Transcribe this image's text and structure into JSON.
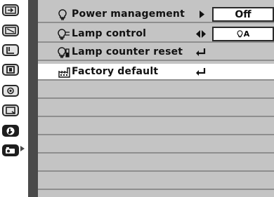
{
  "menu": {
    "items": [
      {
        "label": "Power management",
        "icon": "power-bulb-icon",
        "value": "Off",
        "action": "right-arrow-icon"
      },
      {
        "label": "Lamp control",
        "icon": "lamp-control-icon",
        "value": "A",
        "action": "left-right-arrow-icon"
      },
      {
        "label": "Lamp counter reset",
        "icon": "lamp-counter-icon",
        "action": "enter-icon"
      },
      {
        "label": "Factory default",
        "icon": "factory-default-icon",
        "action": "enter-icon"
      }
    ],
    "empty_rows": 7
  },
  "sidebar": {
    "tabs": [
      {
        "name": "input-icon"
      },
      {
        "name": "image-select-icon"
      },
      {
        "name": "image-adjust-icon"
      },
      {
        "name": "screen-icon"
      },
      {
        "name": "color-icon"
      },
      {
        "name": "setting-icon"
      },
      {
        "name": "info-icon"
      },
      {
        "name": "projector-icon"
      }
    ],
    "active_index": 7
  },
  "colors": {
    "panel": "#c4c4c4",
    "selected_row": "#ffffff",
    "frame": "#4a4a4a"
  }
}
